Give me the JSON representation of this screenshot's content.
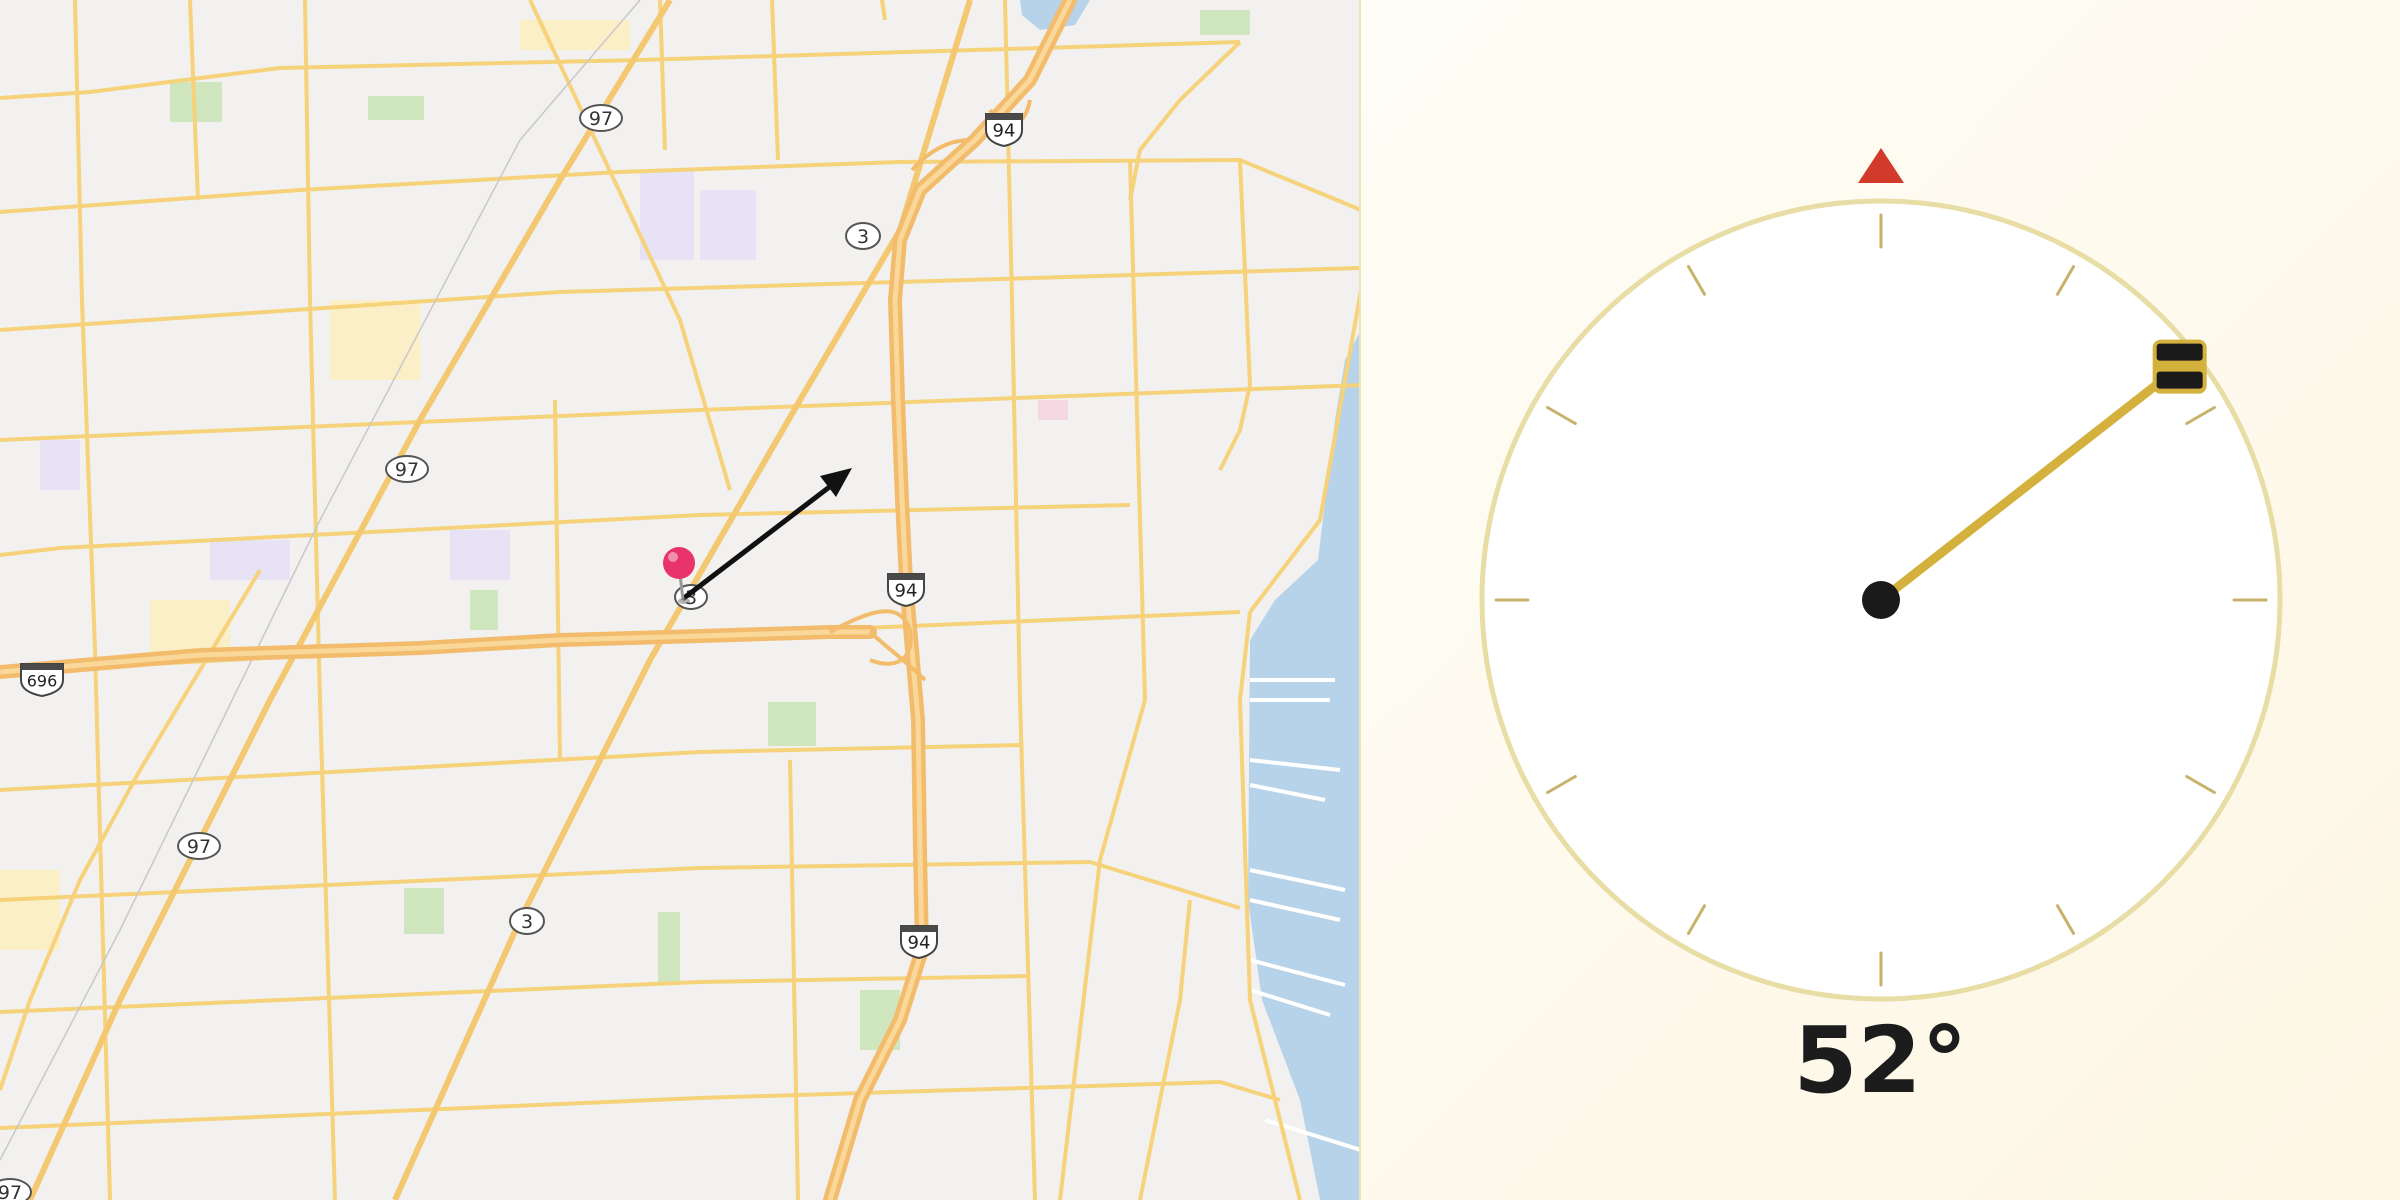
{
  "map": {
    "route_shields": [
      {
        "label": "97",
        "type": "state"
      },
      {
        "label": "97",
        "type": "state"
      },
      {
        "label": "97",
        "type": "state"
      },
      {
        "label": "97",
        "type": "state"
      },
      {
        "label": "3",
        "type": "state"
      },
      {
        "label": "3",
        "type": "state"
      },
      {
        "label": "3",
        "type": "state"
      },
      {
        "label": "94",
        "type": "interstate"
      },
      {
        "label": "94",
        "type": "interstate"
      },
      {
        "label": "94",
        "type": "interstate"
      },
      {
        "label": "696",
        "type": "interstate"
      }
    ],
    "marker": {
      "color": "#e8336d",
      "icon": "map-pin-icon"
    },
    "heading_arrow": {
      "color": "#111111",
      "icon": "direction-arrow-icon"
    },
    "colors": {
      "road": "#f6d27a",
      "highway": "#f2bc6c",
      "water": "#b7d3e9",
      "park": "#c9e2b8",
      "background": "#f2f1ef"
    }
  },
  "compass": {
    "heading_degrees": 52,
    "heading_label": "52°",
    "north_marker_color": "#d23a2a",
    "needle_color": "#d4b13d",
    "ring_color": "#e7dda5",
    "handle_icon": "drag-handle-icon",
    "north_icon": "north-triangle-icon"
  }
}
